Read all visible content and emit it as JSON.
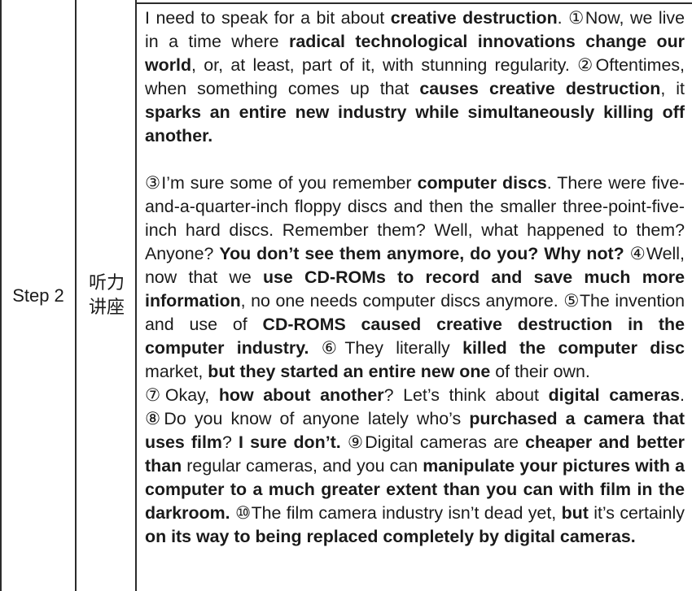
{
  "table": {
    "step_label": "Step 2",
    "type_label": "听力讲座"
  },
  "passage": [
    [
      [
        "I need to speak for a bit about ",
        0
      ],
      [
        "creative destruction",
        1
      ],
      [
        ". ①Now, we live in a time where ",
        0
      ],
      [
        "radical technological innovations change our world",
        1
      ],
      [
        ", or, at least, part of it, with stunning regularity. ②Oftentimes, when something comes up that ",
        0
      ],
      [
        "causes creative destruction",
        1
      ],
      [
        ", it ",
        0
      ],
      [
        "sparks an entire new industry while simultaneously killing off another.",
        1
      ]
    ],
    [
      [
        "③I’m sure some of you remember ",
        0
      ],
      [
        "computer discs",
        1
      ],
      [
        ". There were five-and-a-quarter-inch floppy discs and then the smaller three-point-five-inch hard discs.  Remember them? Well, what happened to them? Anyone? ",
        0
      ],
      [
        "You don’t see them anymore, do you? Why not?",
        1
      ],
      [
        " ④Well, now that we ",
        0
      ],
      [
        "use CD-ROMs to record and save much more information",
        1
      ],
      [
        ", no one needs computer discs anymore. ⑤The invention and use of ",
        0
      ],
      [
        "CD-ROMS caused creative destruction in the computer industry.",
        1
      ],
      [
        " ⑥They literally ",
        0
      ],
      [
        "killed the computer disc",
        1
      ],
      [
        " market, ",
        0
      ],
      [
        "but they started an entire new one",
        1
      ],
      [
        " of their own.",
        0
      ]
    ],
    [
      [
        "⑦Okay, ",
        0
      ],
      [
        "how about another",
        1
      ],
      [
        "? Let’s think about ",
        0
      ],
      [
        "digital cameras",
        1
      ],
      [
        ". ⑧Do you know of anyone lately who’s ",
        0
      ],
      [
        "purchased a camera that uses film",
        1
      ],
      [
        "? ",
        0
      ],
      [
        "I sure don’t.",
        1
      ],
      [
        " ⑨Digital cameras are ",
        0
      ],
      [
        "cheaper and better than",
        1
      ],
      [
        " regular cameras, and you can ",
        0
      ],
      [
        "manipulate your pictures with a computer to a much greater extent than you can with film in the darkroom.",
        1
      ],
      [
        " ⑩The film camera industry isn’t dead yet, ",
        0
      ],
      [
        "but",
        1
      ],
      [
        " it’s certainly ",
        0
      ],
      [
        "on its way to being replaced completely by digital cameras.",
        1
      ]
    ]
  ]
}
